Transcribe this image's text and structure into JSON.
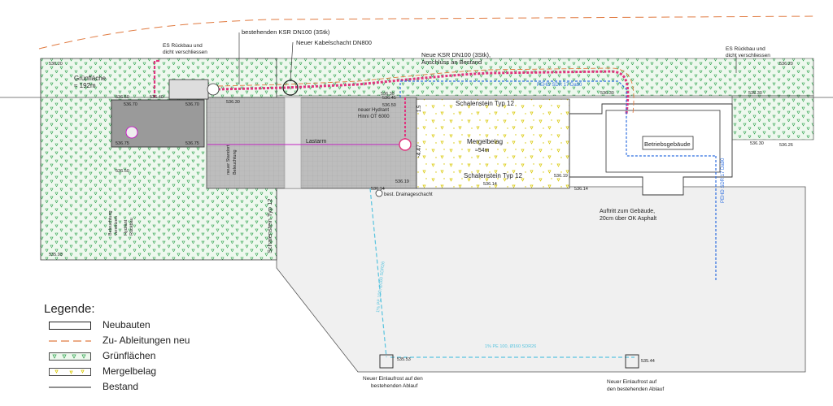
{
  "labels": {
    "es_left": "ES Rückbau und dicht verschliessen",
    "es_left_1": "ES Rückbau und",
    "es_left_2": "dicht verschliessen",
    "ksr_existing": "bestehenden KSR DN100 (3Stk)",
    "kabelschacht": "Neuer Kabelschacht DN800",
    "ksr_new_1": "Neue KSR DN100 (3Stk),",
    "ksr_new_2": "Anschluss an Bestand",
    "es_right_1": "ES Rückbau und",
    "es_right_2": "dicht verschliessen",
    "gruenflaeche_1": "Grünfläche",
    "gruenflaeche_2": "≈ 192m",
    "pehd_top": "PEHD SDR 17 Da90",
    "pehd_right": "PEHD SDR 17 Da90",
    "hydrant_1": "neuer Hydrant",
    "hydrant_2": "Hinni OT 6000",
    "schalenstein_top": "Schalenstein Typ 12",
    "schalenstein_mid": "Schalenstein Typ 12",
    "schalenstein_left": "Schalenstein Typ 12",
    "mergelbelag_1": "Mergelbelag",
    "mergelbelag_2": "≈54m",
    "lastarm": "Lastarm",
    "beleuchtung_1": "neuer Standort",
    "beleuchtung_2": "Beleuchtung",
    "betriebsgebaeude": "Betriebsgebäude",
    "auftritt_1": "Auftritt zum Gebäude,",
    "auftritt_2": "20cm über OK Asphalt",
    "drainage": "best. Drainageschacht",
    "beleuchtung_versetzen_1": "Beleuchtung",
    "beleuchtung_versetzen_2": "versetzen",
    "hydrant_rueckbau_1": "Hydrant",
    "hydrant_rueckbau_2": "Rückbau",
    "pipe_diag": "1% PE 100, Ø160 SDR26",
    "pipe_horiz": "1% PE 100, Ø160 SDR26",
    "einlauf_left_1": "Neuer Einlaufrost auf den",
    "einlauf_left_2": "bestehenden Ablauf",
    "einlauf_right_1": "Neuer Einlaufrost auf",
    "einlauf_right_2": "den bestehenden Ablauf",
    "dim_vert": "-4.47",
    "dim_small": "1.5"
  },
  "elevations": {
    "e1": "536.20",
    "e2": "536.20",
    "e3": "536.50",
    "e4": "536.40",
    "e5": "536.70",
    "e6": "536.70",
    "e7": "536.30",
    "e8": "536.30",
    "e9": "536.30",
    "e10": "536.30",
    "e11": "536.50",
    "e12": "536.75",
    "e13": "536.75",
    "e14": "536.45",
    "e15": "536.50",
    "e16": "536.19",
    "e17": "536.14",
    "e18": "536.14",
    "e19": "536.19",
    "e20": "536.14",
    "e21": "536.30",
    "e22": "536.26",
    "e23": "535.93",
    "e24": "535.53",
    "e25": "535.44"
  },
  "legend": {
    "title": "Legende:",
    "items": [
      {
        "label": "Neubauten",
        "symbol": "box"
      },
      {
        "label": "Zu- Ableitungen neu",
        "symbol": "dash-orange"
      },
      {
        "label": "Grünflächen",
        "symbol": "green-hatch"
      },
      {
        "label": "Mergelbelag",
        "symbol": "mergel"
      },
      {
        "label": "Bestand",
        "symbol": "line"
      }
    ]
  },
  "colors": {
    "green": "#1f9e3a",
    "green_fill": "#e9f6e9",
    "pink": "#e0357f",
    "blue": "#2f6fe0",
    "cyan": "#58c4df",
    "orange": "#e07a40",
    "mergel": "#e8d400",
    "asphalt": "#efefef",
    "paving": "#b9b9b9"
  }
}
